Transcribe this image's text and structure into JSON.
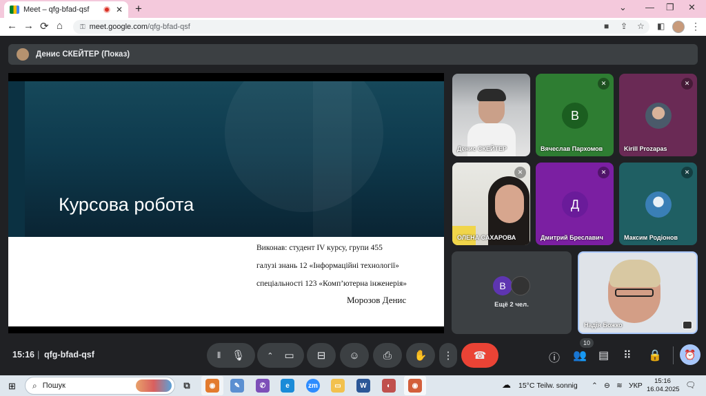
{
  "browser": {
    "tab_title": "Meet – qfg-bfad-qsf",
    "tab_close": "✕",
    "new_tab": "+",
    "url_host": "meet.google.com",
    "url_path": "/qfg-bfad-qsf",
    "win_min": "⌄",
    "win_restore": "❐",
    "win_close": "✕",
    "back": "←",
    "forward": "→",
    "reload": "⟳",
    "home": "⌂"
  },
  "presenter_bar": {
    "label": "Денис СКЕЙТЕР (Показ)"
  },
  "slide": {
    "title": "Курсова робота",
    "line1": "Виконав: студент IV курсу, групи 455",
    "line2": "галузі знань 12 «Інформаційні технології»",
    "line3": "спеціальності 123 «Комп’ютерна інженерія»",
    "author": "Морозов Денис"
  },
  "participants": [
    {
      "name": "Денис СКЕЙТЕР",
      "letter": ""
    },
    {
      "name": "Вячеслав Пархомов",
      "letter": "В",
      "color": "#2e7d32"
    },
    {
      "name": "Kirill Prozapas",
      "letter": "",
      "color": "#6a2a55"
    },
    {
      "name": "ОЛЕНА САХАРОВА",
      "letter": ""
    },
    {
      "name": "Дмитрий Бреславич",
      "letter": "Д",
      "color": "#7b1fa2"
    },
    {
      "name": "Максим Родіонов",
      "letter": "",
      "color": "#1f5f63"
    }
  ],
  "more": {
    "letter": "В",
    "label": "Ещё 2 чел."
  },
  "self": {
    "name": "Надія Божко"
  },
  "controls": {
    "time": "15:16",
    "separator": "|",
    "meeting_code": "qfg-bfad-qsf",
    "people_count": "10"
  },
  "taskbar": {
    "search_placeholder": "Пошук",
    "weather": "15°C  Teilw. sonnig",
    "lang": "УКР",
    "time": "15:16",
    "date": "16.04.2025"
  },
  "colors": {
    "end_call": "#ea4335",
    "meet_bg": "#202124",
    "tile_bg": "#3c4043",
    "accent": "#a8c7fa"
  }
}
